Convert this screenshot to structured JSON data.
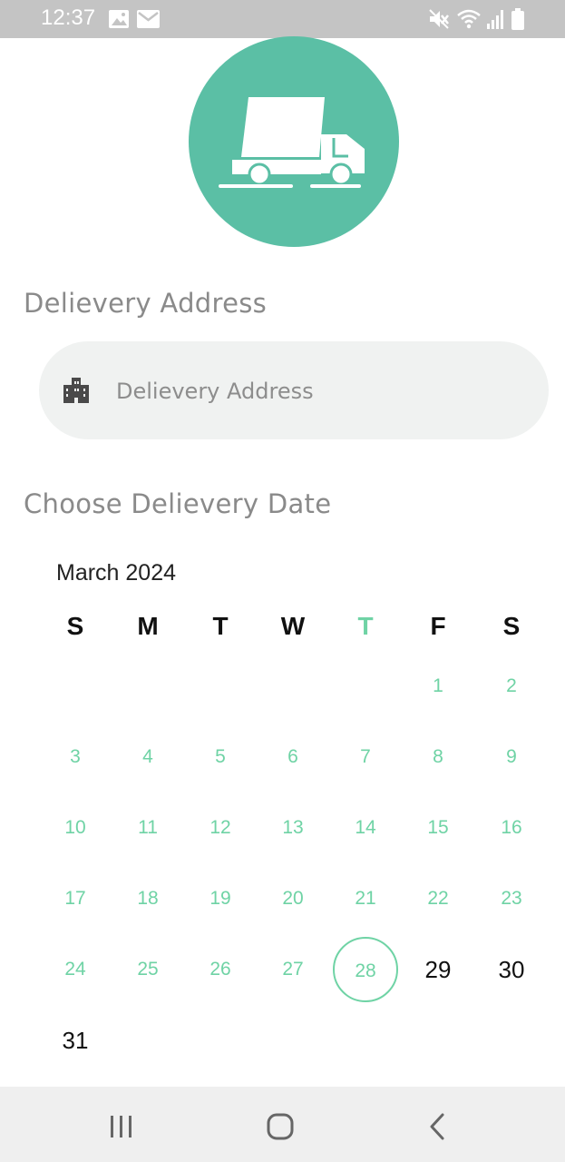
{
  "status_bar": {
    "time": "12:37",
    "icons": [
      "image-icon",
      "mail-icon",
      "mute-icon",
      "wifi-icon",
      "signal-icon",
      "battery-icon"
    ]
  },
  "colors": {
    "accent": "#5bbfa5",
    "calendar_accent": "#6fd3a5",
    "status_bar": "#c4c4c4",
    "input_bg": "#f0f2f1"
  },
  "hero": {
    "icon": "delivery-truck-icon"
  },
  "address": {
    "section_title": "Delievery Address",
    "placeholder": "Delievery Address",
    "value": "",
    "icon": "building-icon"
  },
  "date": {
    "section_title": "Choose Delievery Date",
    "month": "March 2024",
    "weekdays": [
      "S",
      "M",
      "T",
      "W",
      "T",
      "F",
      "S"
    ],
    "today_weekday_index": 4,
    "first_weekday_index": 5,
    "days": [
      "1",
      "2",
      "3",
      "4",
      "5",
      "6",
      "7",
      "8",
      "9",
      "10",
      "11",
      "12",
      "13",
      "14",
      "15",
      "16",
      "17",
      "18",
      "19",
      "20",
      "21",
      "22",
      "23",
      "24",
      "25",
      "26",
      "27",
      "28",
      "29",
      "30",
      "31"
    ],
    "selected_day": "28",
    "past_days_through": 28
  },
  "nav_bar": {
    "buttons": [
      "recent-apps-icon",
      "home-icon",
      "back-icon"
    ]
  }
}
